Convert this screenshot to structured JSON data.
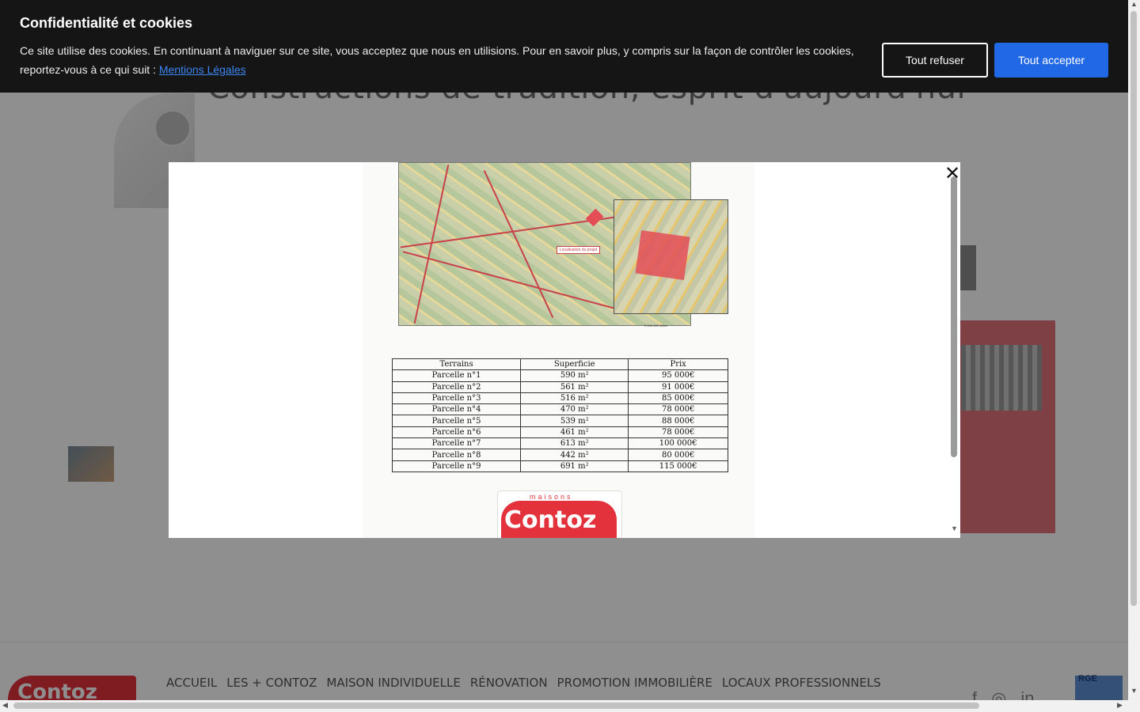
{
  "page": {
    "title": "Constructions de tradition, esprit d'aujourd'hui"
  },
  "cookie_banner": {
    "heading": "Confidentialité et cookies",
    "text": "Ce site utilise des cookies. En continuant à naviguer sur ce site, vous acceptez que nous en utilisions. Pour en savoir plus, y compris sur la façon de contrôler les cookies, reportez-vous à ce qui suit :",
    "link_label": "Mentions Légales",
    "refuse_label": "Tout refuser",
    "accept_label": "Tout accepter",
    "accent_color": "#2168e6"
  },
  "modal": {
    "close_glyph": "✕",
    "document": {
      "map_label": "Localisation du projet",
      "scale_text": "0   100   200   300m",
      "table": {
        "headers": [
          "Terrains",
          "Superficie",
          "Prix"
        ],
        "rows": [
          [
            "Parcelle n°1",
            "590 m²",
            "95 000€"
          ],
          [
            "Parcelle n°2",
            "561 m²",
            "91 000€"
          ],
          [
            "Parcelle n°3",
            "516 m²",
            "85 000€"
          ],
          [
            "Parcelle n°4",
            "470 m²",
            "78 000€"
          ],
          [
            "Parcelle n°5",
            "539 m²",
            "88 000€"
          ],
          [
            "Parcelle n°6",
            "461 m²",
            "78 000€"
          ],
          [
            "Parcelle n°7",
            "613 m²",
            "100 000€"
          ],
          [
            "Parcelle n°8",
            "442 m²",
            "80 000€"
          ],
          [
            "Parcelle n°9",
            "691 m²",
            "115 000€"
          ]
        ]
      },
      "logo_small": "maisons",
      "logo_brand": "Contoz"
    }
  },
  "footer": {
    "logo_brand": "Contoz",
    "nav": [
      "ACCUEIL",
      "LES + CONTOZ",
      "MAISON INDIVIDUELLE",
      "RÉNOVATION",
      "PROMOTION IMMOBILIÈRE",
      "LOCAUX PROFESSIONNELS"
    ],
    "rge_label": "RGE",
    "brand_color": "#e3323b"
  },
  "icons": [
    "close-icon",
    "facebook-icon",
    "instagram-icon",
    "linkedin-icon"
  ]
}
